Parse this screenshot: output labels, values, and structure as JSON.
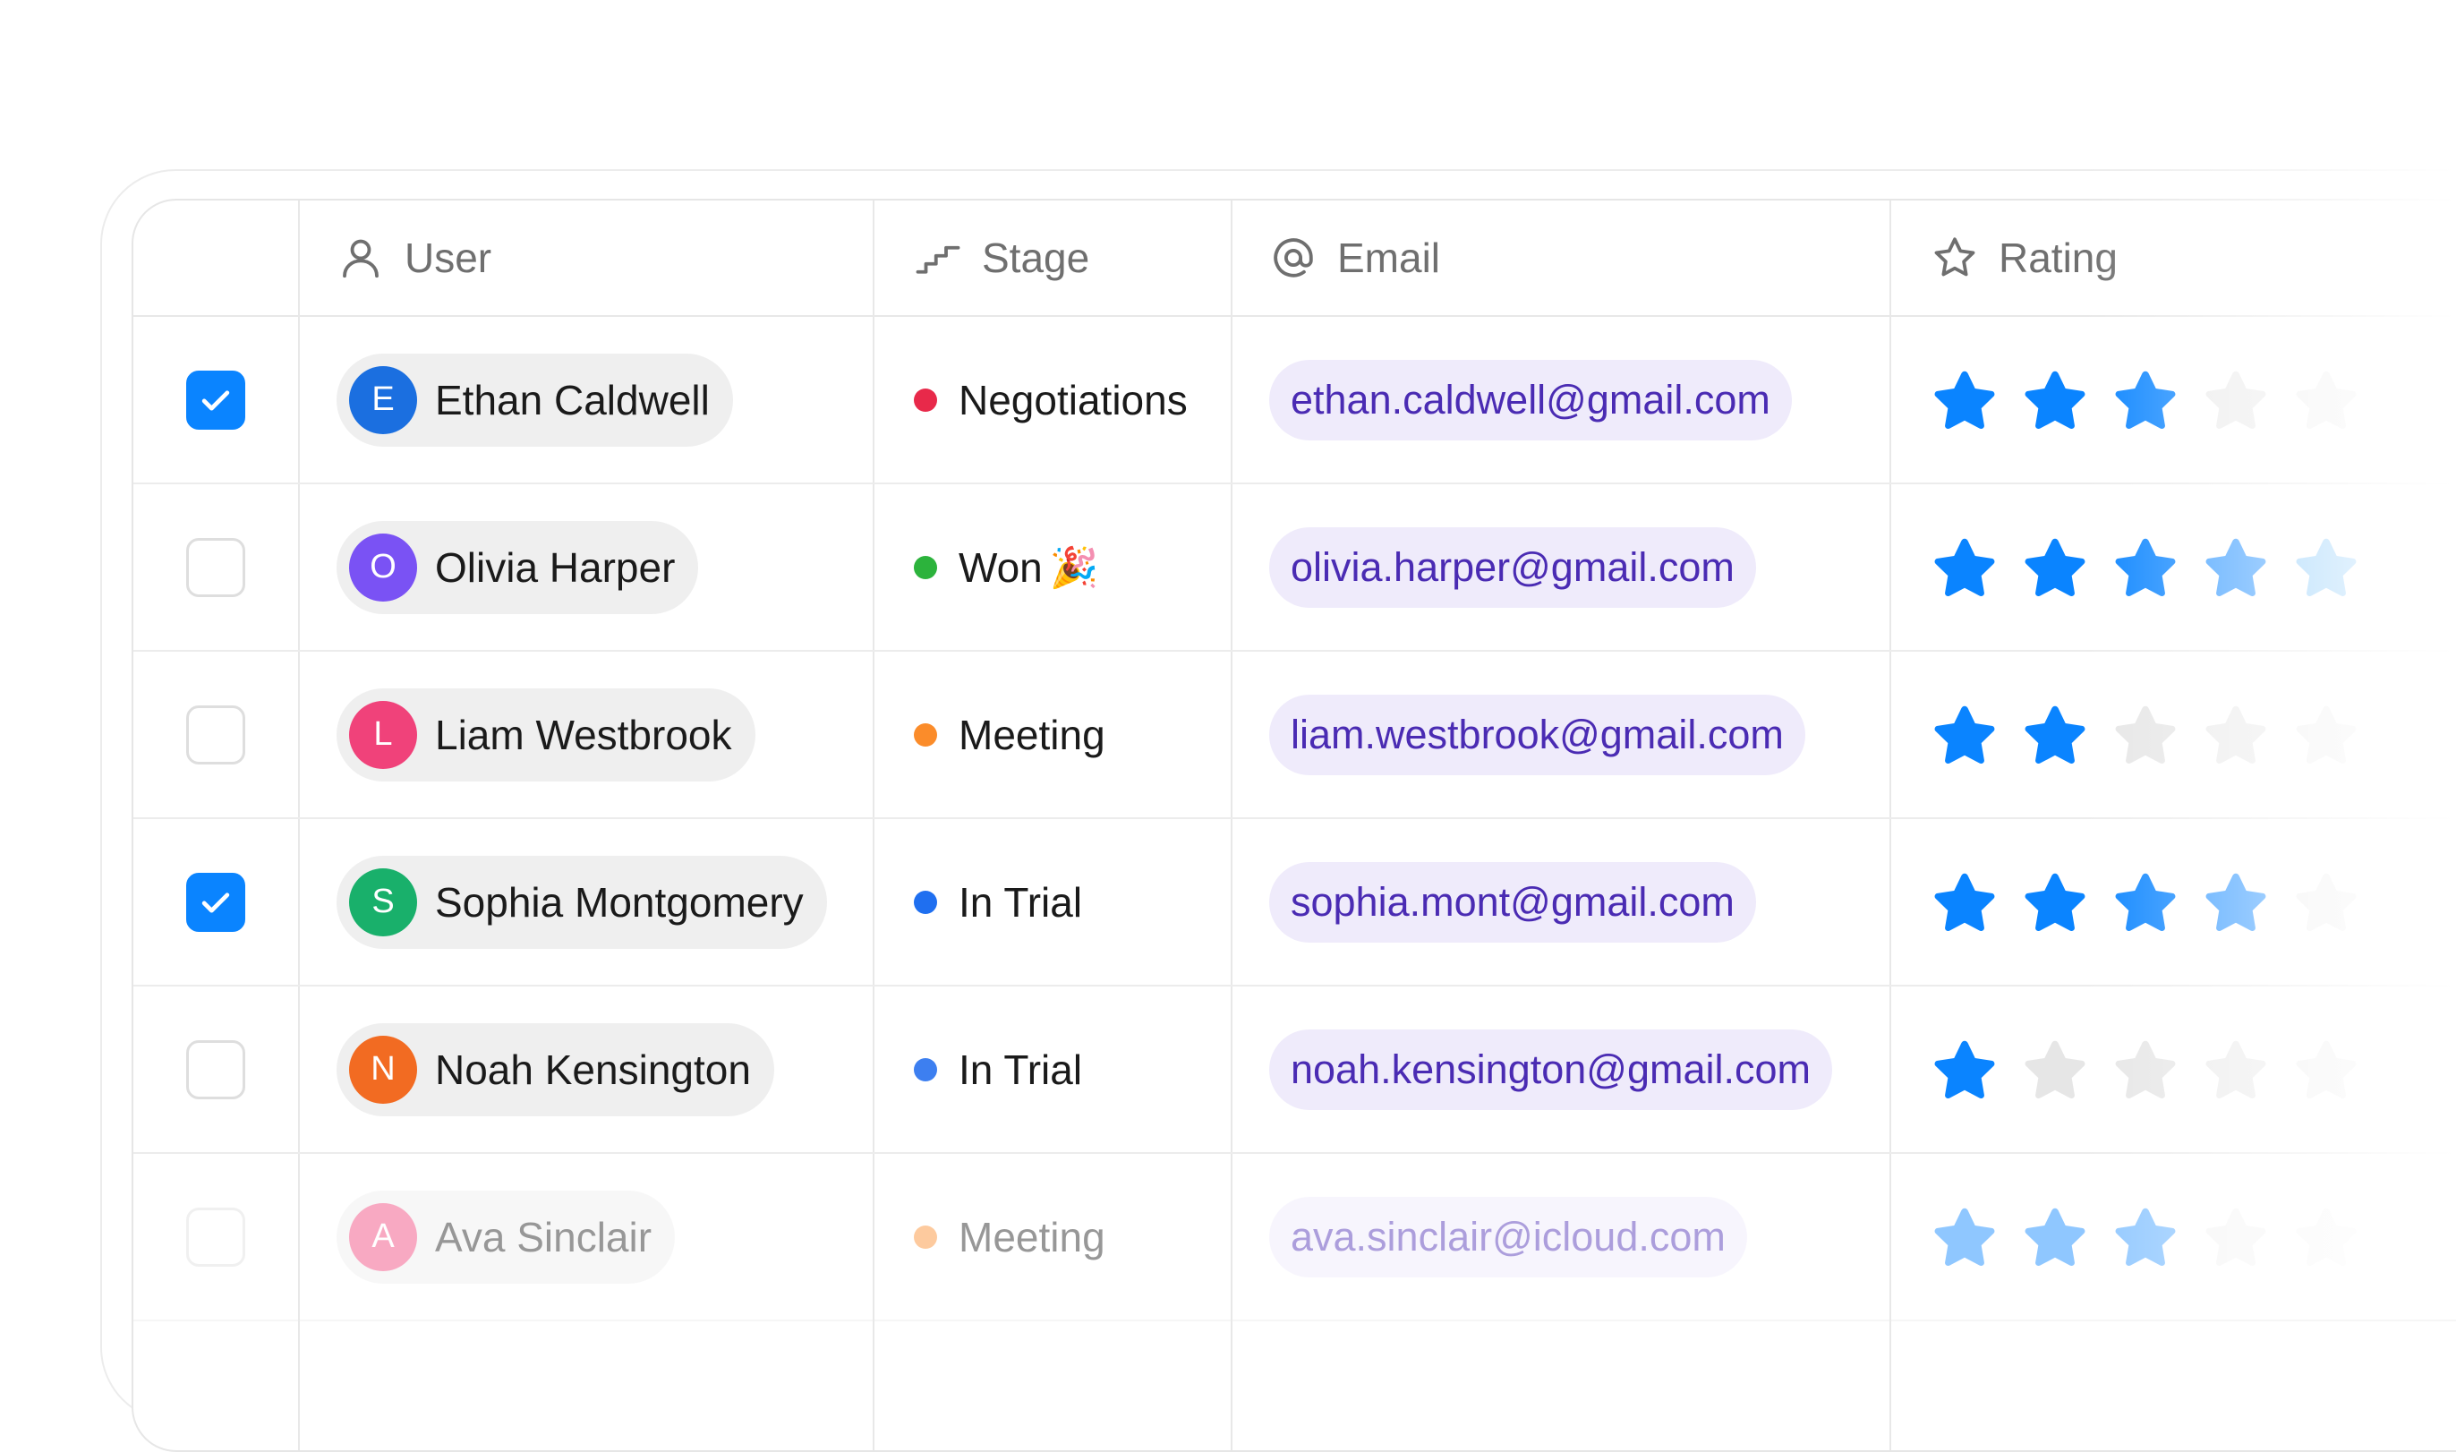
{
  "columns": {
    "user": {
      "label": "User",
      "icon": "user-icon"
    },
    "stage": {
      "label": "Stage",
      "icon": "stairs-icon"
    },
    "email": {
      "label": "Email",
      "icon": "at-icon"
    },
    "rating": {
      "label": "Rating",
      "icon": "star-icon"
    }
  },
  "colors": {
    "accent": "#0a84ff",
    "email_text": "#4a2bb3",
    "email_chip": "#efebfb",
    "star_empty": "#e6e6e6"
  },
  "rows": [
    {
      "checked": true,
      "initial": "E",
      "name": "Ethan Caldwell",
      "avatar_color": "#1b6fe0",
      "stage": "Negotiations",
      "stage_color": "#e8294a",
      "stage_emoji": "",
      "email": "ethan.caldwell@gmail.com",
      "rating": 3,
      "rating_max": 5
    },
    {
      "checked": false,
      "initial": "O",
      "name": "Olivia Harper",
      "avatar_color": "#7a52f4",
      "stage": "Won",
      "stage_color": "#2cb33c",
      "stage_emoji": "🎉",
      "email": "olivia.harper@gmail.com",
      "rating": 5,
      "rating_max": 5
    },
    {
      "checked": false,
      "initial": "L",
      "name": "Liam Westbrook",
      "avatar_color": "#f0427a",
      "stage": "Meeting",
      "stage_color": "#fb8c2a",
      "stage_emoji": "",
      "email": "liam.westbrook@gmail.com",
      "rating": 2,
      "rating_max": 5
    },
    {
      "checked": true,
      "initial": "S",
      "name": "Sophia Montgomery",
      "avatar_color": "#19b06b",
      "stage": "In Trial",
      "stage_color": "#1f6ff0",
      "stage_emoji": "",
      "email": "sophia.mont@gmail.com",
      "rating": 4,
      "rating_max": 5
    },
    {
      "checked": false,
      "initial": "N",
      "name": "Noah Kensington",
      "avatar_color": "#f26b22",
      "stage": "In Trial",
      "stage_color": "#3d7ff0",
      "stage_emoji": "",
      "email": "noah.kensington@gmail.com",
      "rating": 1,
      "rating_max": 5
    },
    {
      "checked": false,
      "initial": "A",
      "name": "Ava Sinclair",
      "avatar_color": "#f0427a",
      "stage": "Meeting",
      "stage_color": "#fb8c2a",
      "stage_emoji": "",
      "email": "ava.sinclair@icloud.com",
      "rating": 3,
      "rating_max": 5
    }
  ]
}
